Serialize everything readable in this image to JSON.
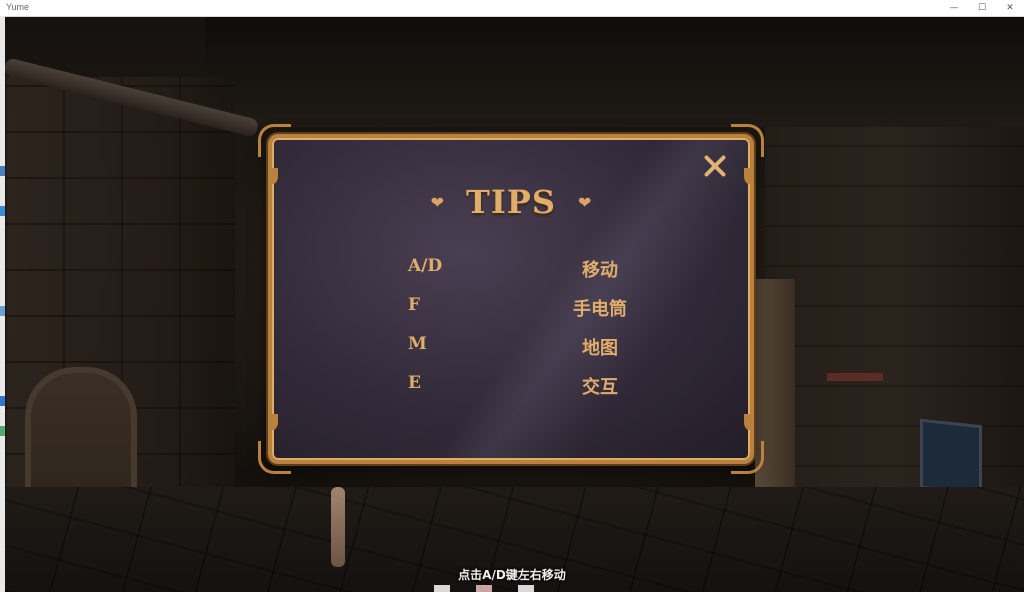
{
  "window": {
    "title": "Yume",
    "minimize_glyph": "—",
    "maximize_glyph": "☐",
    "close_glyph": "✕"
  },
  "dialog": {
    "title": "TIPS",
    "heart_glyph": "❤",
    "close_icon": "close-x-icon",
    "accent_color": "#e0ad6c",
    "rows": [
      {
        "key": "A/D",
        "action": "移动"
      },
      {
        "key": "F",
        "action": "手电筒"
      },
      {
        "key": "M",
        "action": "地图"
      },
      {
        "key": "E",
        "action": "交互"
      }
    ]
  },
  "hint": "点击A/D键左右移动"
}
